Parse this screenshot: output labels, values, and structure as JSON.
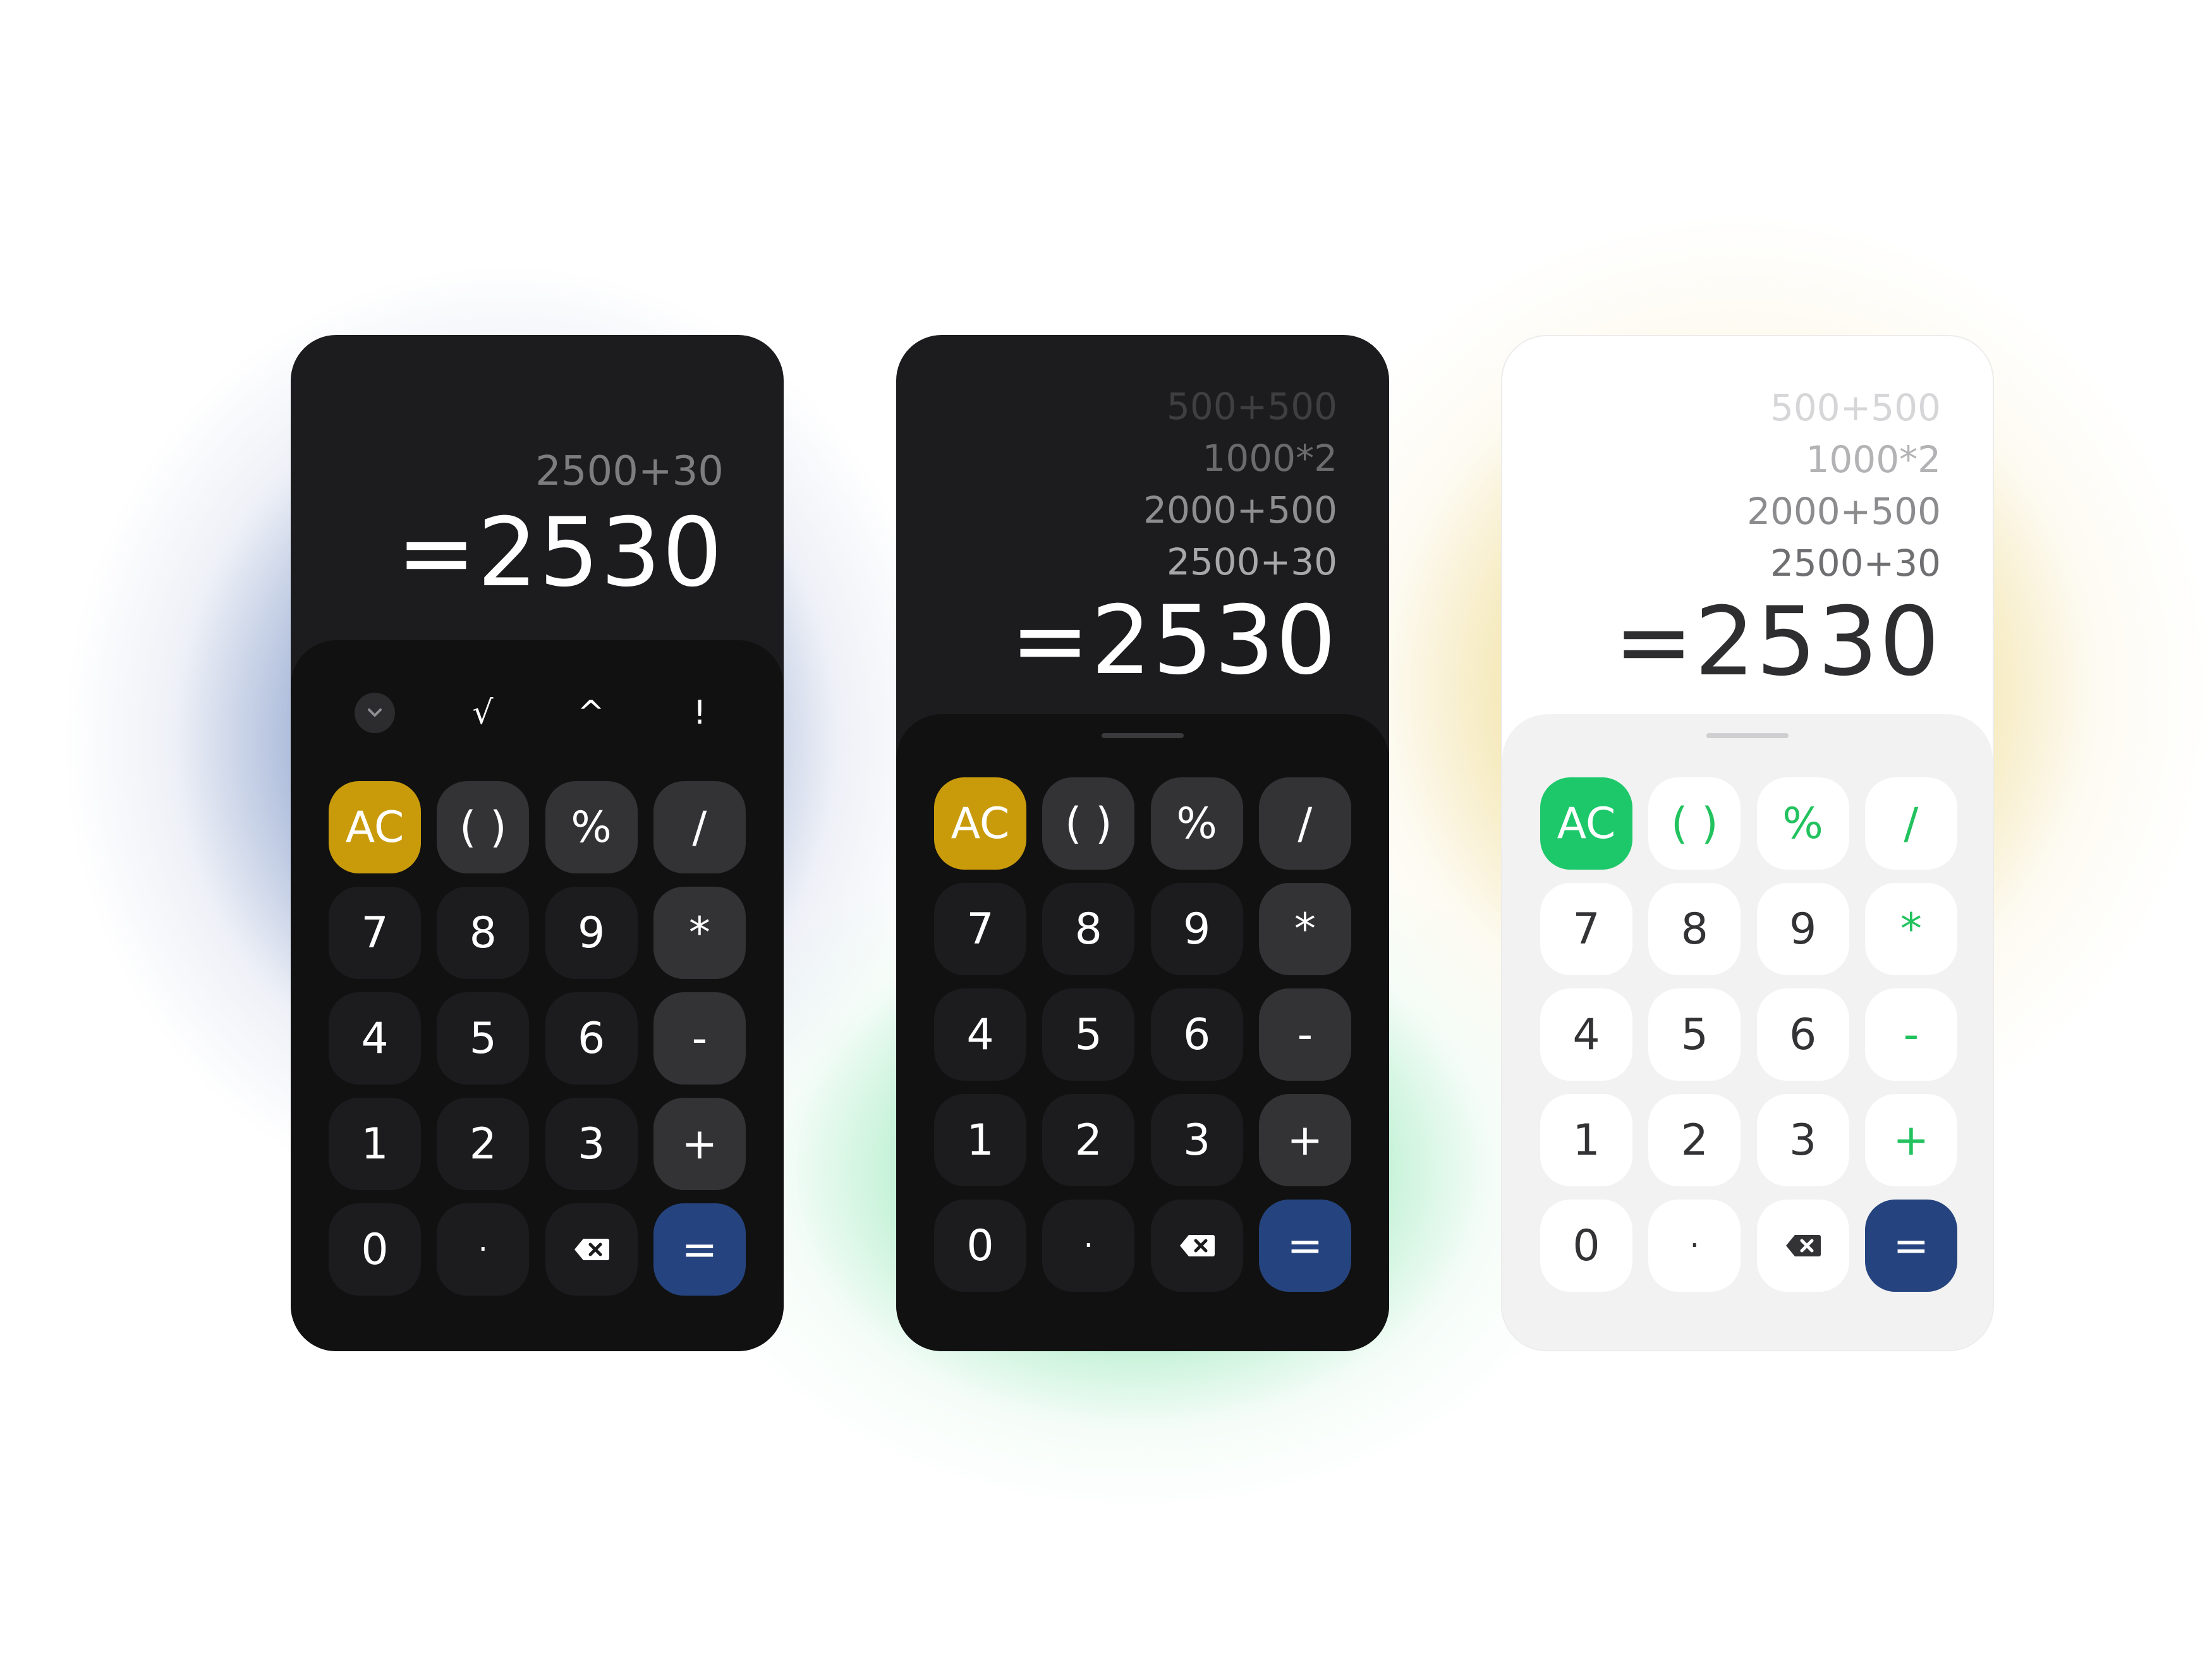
{
  "colors": {
    "dark_bg": "#1c1c1e",
    "dark_keypad_bg": "#111112",
    "accent_yellow": "#c99b0b",
    "accent_blue": "#25447f",
    "accent_green": "#1dc86a",
    "light_keypad_bg": "#f2f2f2"
  },
  "card1": {
    "history": [
      "2500+30"
    ],
    "result": "=2530",
    "scientific": {
      "collapse_icon": "chevron-down-icon",
      "sqrt": "√",
      "power": "^",
      "factorial": "!"
    },
    "keys": [
      "AC",
      "( )",
      "%",
      "/",
      "7",
      "8",
      "9",
      "*",
      "4",
      "5",
      "6",
      "-",
      "1",
      "2",
      "3",
      "+",
      "0",
      "·",
      "backspace",
      "="
    ]
  },
  "card2": {
    "history": [
      "500+500",
      "1000*2",
      "2000+500",
      "2500+30"
    ],
    "result": "=2530",
    "keys": [
      "AC",
      "( )",
      "%",
      "/",
      "7",
      "8",
      "9",
      "*",
      "4",
      "5",
      "6",
      "-",
      "1",
      "2",
      "3",
      "+",
      "0",
      "·",
      "backspace",
      "="
    ]
  },
  "card3": {
    "history": [
      "500+500",
      "1000*2",
      "2000+500",
      "2500+30"
    ],
    "result": "=2530",
    "keys": [
      "AC",
      "( )",
      "%",
      "/",
      "7",
      "8",
      "9",
      "*",
      "4",
      "5",
      "6",
      "-",
      "1",
      "2",
      "3",
      "+",
      "0",
      "·",
      "backspace",
      "="
    ]
  }
}
